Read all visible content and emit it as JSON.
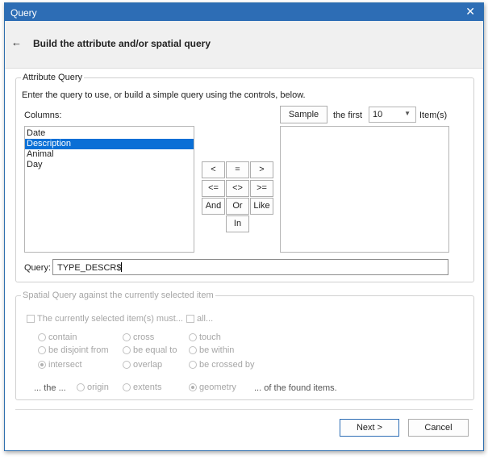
{
  "window": {
    "title": "Query",
    "close_glyph": "✕",
    "close_icon": "close-icon"
  },
  "header": {
    "back_glyph": "←",
    "back_icon": "back-arrow-icon",
    "title": "Build the attribute and/or spatial query"
  },
  "attribute": {
    "group_label": "Attribute Query",
    "instructions": "Enter the query to use, or build a simple query using the controls, below.",
    "columns_label": "Columns:",
    "columns": [
      "Date",
      "Description",
      "Animal",
      "Day"
    ],
    "selected_column": "Description",
    "operators": [
      "<",
      "=",
      ">",
      "<=",
      "<>",
      ">=",
      "And",
      "Or",
      "Like",
      "In"
    ],
    "sample_button": "Sample",
    "the_first_label": "the first",
    "sample_count": "10",
    "items_label": "Item(s)",
    "query_label": "Query:",
    "query_value": "TYPE_DESCR$"
  },
  "spatial": {
    "group_label": "Spatial Query against the currently selected item",
    "must_label": "The currently selected item(s) must...",
    "all_label": "all...",
    "relations": [
      "contain",
      "cross",
      "touch",
      "be disjoint from",
      "be equal to",
      "be within",
      "intersect",
      "overlap",
      "be crossed by"
    ],
    "selected_relation": "intersect",
    "the_label": "... the ...",
    "geometry_options": [
      "origin",
      "extents",
      "geometry"
    ],
    "selected_geometry": "geometry",
    "found_label": "... of the found items."
  },
  "footer": {
    "next_button": "Next >",
    "cancel_button": "Cancel"
  },
  "colors": {
    "title_bar": "#2d6db5",
    "selection": "#0a6fd6",
    "disabled_text": "#a6a6a6"
  }
}
